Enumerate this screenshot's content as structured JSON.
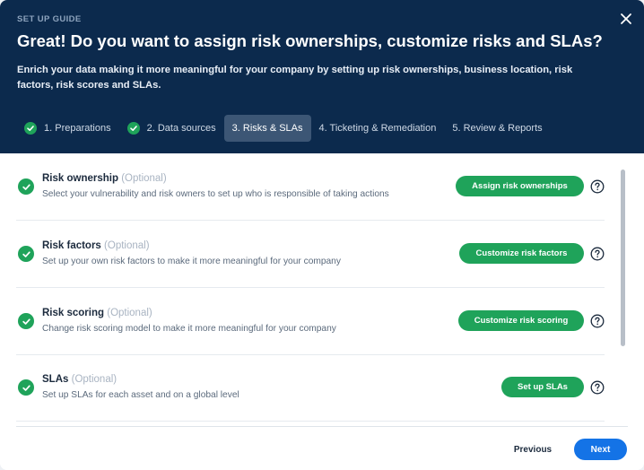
{
  "header": {
    "kicker": "SET UP GUIDE",
    "title": "Great! Do you want to assign risk ownerships, customize risks and SLAs?",
    "description": "Enrich your data making it more meaningful for your company by setting up risk ownerships, business location, risk factors, risk scores and SLAs.",
    "close_icon": "close-icon"
  },
  "steps": [
    {
      "label": "1. Preparations",
      "completed": true,
      "active": false
    },
    {
      "label": "2. Data sources",
      "completed": true,
      "active": false
    },
    {
      "label": "3. Risks & SLAs",
      "completed": false,
      "active": true
    },
    {
      "label": "4. Ticketing & Remediation",
      "completed": false,
      "active": false
    },
    {
      "label": "5. Review & Reports",
      "completed": false,
      "active": false
    }
  ],
  "items": [
    {
      "title": "Risk ownership",
      "optional": "(Optional)",
      "description": "Select your vulnerability and risk owners to set up who is responsible of taking actions",
      "button": "Assign  risk ownerships",
      "completed": true
    },
    {
      "title": "Risk factors",
      "optional": "(Optional)",
      "description": "Set up your own risk factors to make it more meaningful for your company",
      "button": "Customize risk factors",
      "completed": true
    },
    {
      "title": "Risk scoring",
      "optional": "(Optional)",
      "description": "Change risk scoring model to make it more meaningful for your company",
      "button": "Customize risk scoring",
      "completed": true
    },
    {
      "title": "SLAs",
      "optional": "(Optional)",
      "description": "Set up SLAs for each asset and on a global level",
      "button": "Set up SLAs",
      "completed": true
    }
  ],
  "footer": {
    "previous_label": "Previous",
    "next_label": "Next"
  },
  "colors": {
    "header_bg": "#0c2a4d",
    "success": "#1fa35a",
    "primary": "#1473e6",
    "active_step": "#3c5675"
  }
}
